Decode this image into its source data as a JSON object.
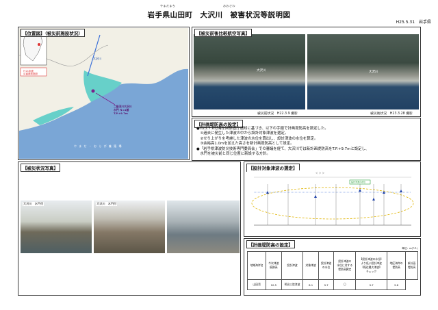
{
  "header": {
    "title": "岩手県山田町　大沢川　被害状況等説明図",
    "ruby_yamada": "やまだまち",
    "ruby_osawa": "おおさわ",
    "date": "H25.5.31",
    "org": "岩手県"
  },
  "sections": {
    "location": "【位置図】（被災前施設状況）",
    "aerial": "【被災前後比較航空写真】",
    "planning": "【計画堤防高の設定】",
    "damage_photos": "【被災状況写真】",
    "design_tsunami": "【設計対象津波の選定】",
    "height_table": "【計画堤防高の設定】"
  },
  "map": {
    "river_label": "大沢川",
    "gate_label": "二級河川大沢川\n水門 Ｎ=1基\nT.P.+9.7m",
    "bay_label": "や ま だ ・ お ら が 養 殖 場",
    "legend_top": "Ｈ21年度",
    "legend_red": "災害救助施設"
  },
  "aerial": {
    "before_caption": "被災前状況　H22.3.9 撮影",
    "after_caption": "被災後状況　H23.3.28 撮影",
    "label": "大沢川"
  },
  "planning_text": [
    "●H23.7.6付海岸関係省庁通知に基づき、以下の手順で計画堤防高を設定した。",
    "　①過去に発生した津波の中から設計対象津波を選定。",
    "　②せり上がりを考慮した津波の水位を算出し、設計津波の水位を算定。",
    "　③余裕高1.0mを加えた高さを新計画堤防高として設定。",
    "●「岩手県津波防災技術専門委員会」での審議を経て、大沢川では新計画堤防高をT.P.+9.7mと設定し、",
    "　水門を被災前と同じ位置に新設する方針。"
  ],
  "damage_photos": {
    "photo1_label": "大沢川　水門付",
    "photo2_label": "大沢川　水門付"
  },
  "design_chart": {
    "top_label": "＜ ＞ ＞",
    "legend": "設計津波の水位"
  },
  "height_table": {
    "unit": "単位：m(T.P.)",
    "headers": [
      "地域海岸名",
      "今次津波\n痕跡高",
      "設計津波",
      "対象津波",
      "設計津波\nの水位",
      "設計津波の\n水位に対する\n堤防高算定",
      "【設計津波の水位】\nより低い設計津波\n【既往最大津波】\nチェック",
      "地区海岸の\n堤防高",
      "新計画\n堤防高"
    ],
    "row": [
      "山田湾",
      "10.5",
      "明治三陸津波",
      "8.1",
      "9.7",
      "〇",
      "9.7",
      "9.6"
    ]
  }
}
